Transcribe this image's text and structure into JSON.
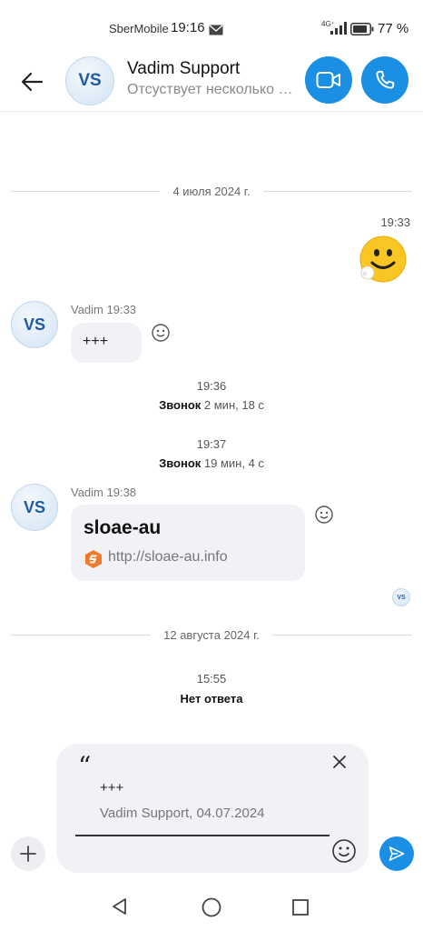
{
  "status_bar": {
    "carrier": "SberMobile",
    "time": "19:16",
    "network": "4G⁺",
    "battery_percent": "77 %"
  },
  "header": {
    "avatar_initials": "VS",
    "contact_name": "Vadim Support",
    "contact_status": "Отсуствует несколько часов"
  },
  "conversation": {
    "date_1": "4 июля 2024 г.",
    "outgoing_time": "19:33",
    "msg1_sender": "Vadim 19:33",
    "msg1_text": "+++",
    "call1_time": "19:36",
    "call1_label": "Звонок",
    "call1_duration": "2 мин, 18 с",
    "call2_time": "19:37",
    "call2_label": "Звонок",
    "call2_duration": "19 мин, 4 с",
    "msg2_sender": "Vadim 19:38",
    "link_title": "sloae-au",
    "link_url": "http://sloae-au.info",
    "read_receipt_initials": "VS",
    "date_2": "12 августа 2024 г.",
    "call3_time": "15:55",
    "call3_label": "Нет ответа"
  },
  "composer": {
    "quote_mark": "“",
    "quote_text": "+++",
    "quote_source": "Vadim Support, 04.07.2024"
  },
  "colors": {
    "accent": "#1b8fe3",
    "bubble": "#f0f2f5",
    "avatar_text": "#1f5aa6",
    "link_icon": "#f07b2b"
  }
}
